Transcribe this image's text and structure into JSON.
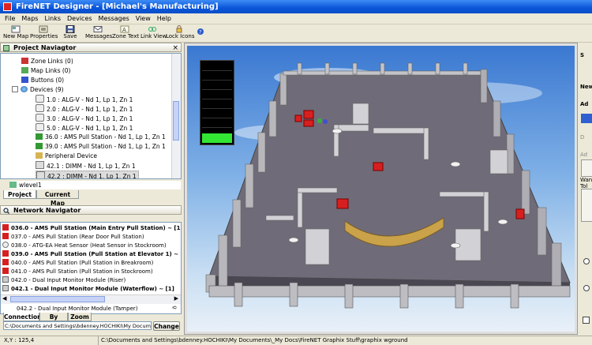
{
  "window": {
    "title": "FireNET Designer - [Michael's Manufacturing]"
  },
  "menu": [
    "File",
    "Maps",
    "Links",
    "Devices",
    "Messages",
    "View",
    "Help"
  ],
  "toolbar": {
    "new_map": "New Map",
    "properties": "Properties",
    "save": "Save",
    "messages": "Messages",
    "zone_text": "Zone Text",
    "link_view": "Link View",
    "lock_icons": "Lock Icons"
  },
  "project_navigator": {
    "title": "Project Naviagtor",
    "items": [
      "Zone Links (0)",
      "Map Links (0)",
      "Buttons (0)",
      "Devices (9)",
      "1.0 : ALG-V - Nd 1, Lp 1, Zn 1",
      "2.0 : ALG-V - Nd 1, Lp 1, Zn 1",
      "3.0 : ALG-V - Nd 1, Lp 1, Zn 1",
      "5.0 : ALG-V - Nd 1, Lp 1, Zn 1",
      "36.0 : AMS Pull Station - Nd 1, Lp 1, Zn 1",
      "39.0 : AMS Pull Station - Nd 1, Lp 1, Zn 1",
      "Peripheral Device",
      "42.1 : DIMM - Nd 1, Lp 1, Zn 1",
      "42.2 : DIMM - Nd 1, Lp 1, Zn 1",
      "wlevel1"
    ],
    "tabs": [
      "Project",
      "Current Map"
    ]
  },
  "network_navigator": {
    "title": "Network Navigator",
    "items": [
      "036.0 - AMS Pull Station (Main Entry Pull Station) ~ [1]",
      "037.0 - AMS Pull Station (Rear Door Pull Station)",
      "038.0 - ATG-EA Heat Sensor (Heat Sensor in Stockroom)",
      "039.0 - AMS Pull Station (Pull Station at Elevator 1) ~ [1]",
      "040.0 - AMS Pull Station (Pull Station in Breakroom)",
      "041.0 - AMS Pull Station (Pull Station in Stockroom)",
      "042.0 - Dual Input Monitor Module (Riser)",
      "042.1 - Dual Input Monitor Module (Waterflow) ~ [1]",
      "042.2 - Dual Input Monitor Module (Tamper)"
    ],
    "tabs": [
      "Connection",
      "By Zone",
      "Zoom"
    ],
    "path_value": "C:\\Documents and Settings\\bdenney.HOCHIKI\\My Documents\\",
    "change_label": "Change"
  },
  "right_panel": {
    "labels": [
      "S",
      "New",
      "Ad",
      "D",
      "Ad",
      "Wan",
      "Tol"
    ]
  },
  "status": {
    "coords": "X,Y : 125,4",
    "path": "C:\\Documents and Settings\\bdenney.HOCHIKI\\My Documents\\_My Docs\\FireNET Graphix Stuff\\graphix wground"
  },
  "colors": {
    "accent": "#0a55d8",
    "alarm": "#d81f1f",
    "meter_level": "#33e633"
  }
}
